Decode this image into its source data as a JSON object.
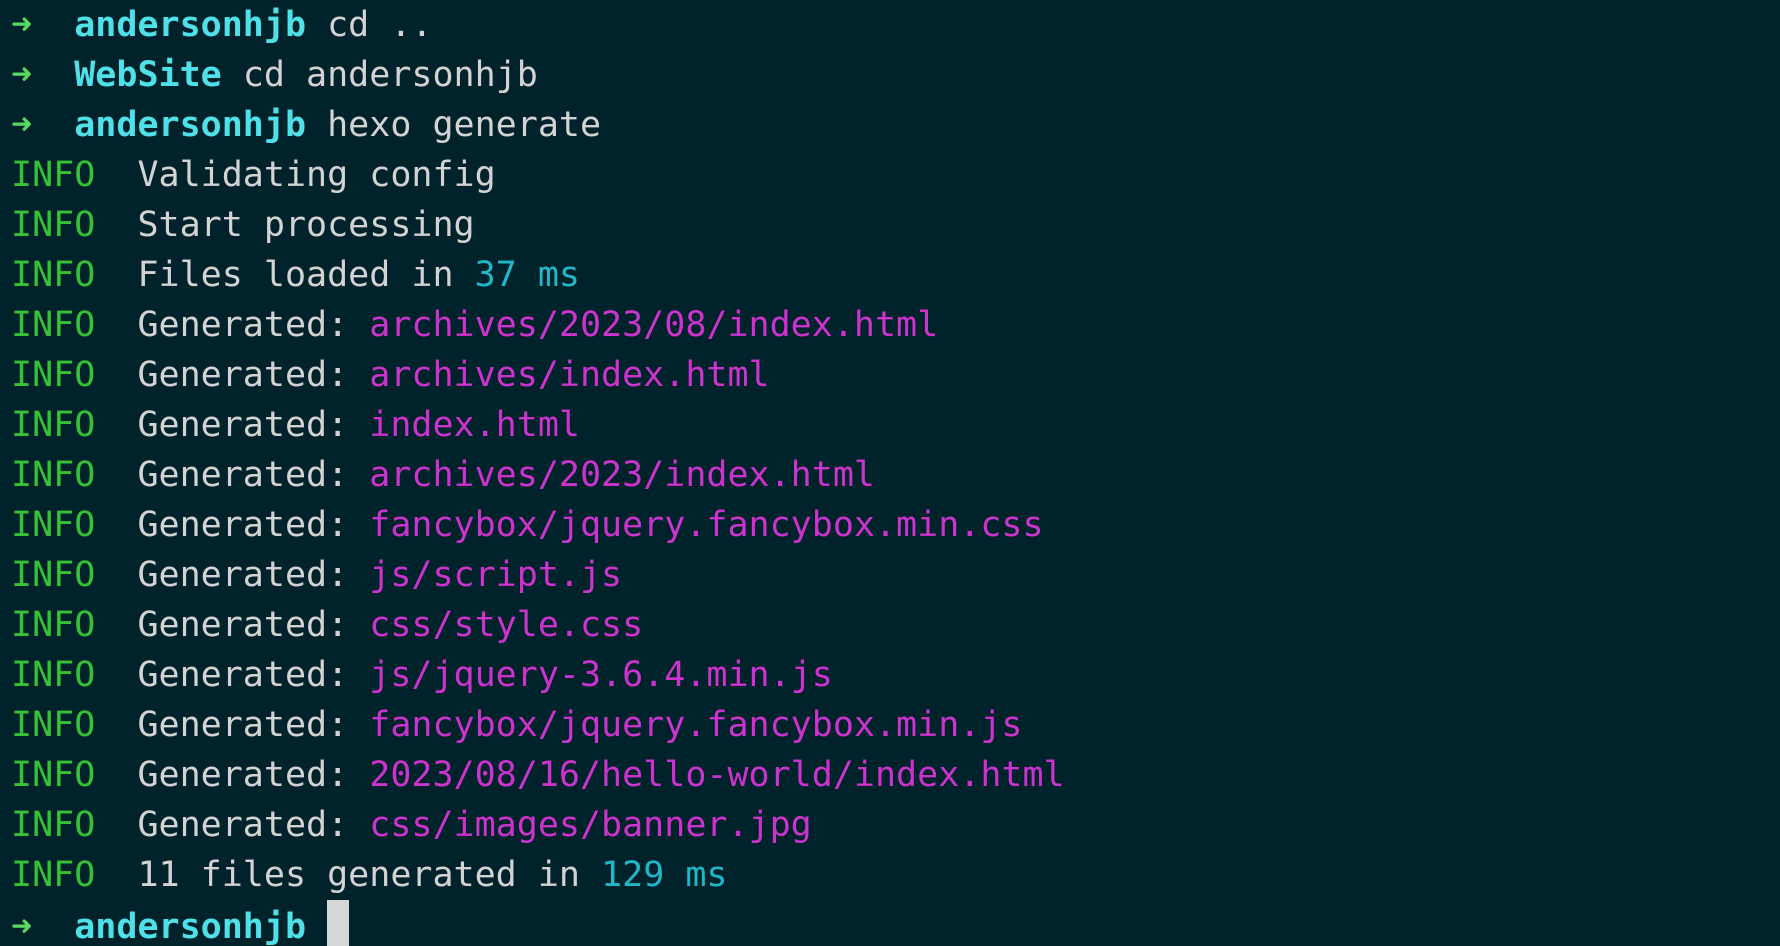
{
  "colors": {
    "background": "#00222b",
    "prompt_arrow": "#5ad962",
    "directory": "#4fe0e8",
    "info": "#36c236",
    "path": "#cc33cc",
    "number": "#20b8c8",
    "text": "#d3d3d3"
  },
  "prompt_symbol": "➜",
  "commands": [
    {
      "dir": "andersonhjb",
      "cmd": "cd .."
    },
    {
      "dir": "WebSite",
      "cmd": "cd andersonhjb"
    },
    {
      "dir": "andersonhjb",
      "cmd": "hexo generate"
    }
  ],
  "log": {
    "level": "INFO",
    "validating": "Validating config",
    "processing": "Start processing",
    "files_loaded_prefix": "Files loaded in",
    "files_loaded_value": "37 ms",
    "generated_label": "Generated:",
    "generated_files": [
      "archives/2023/08/index.html",
      "archives/index.html",
      "index.html",
      "archives/2023/index.html",
      "fancybox/jquery.fancybox.min.css",
      "js/script.js",
      "css/style.css",
      "js/jquery-3.6.4.min.js",
      "fancybox/jquery.fancybox.min.js",
      "2023/08/16/hello-world/index.html",
      "css/images/banner.jpg"
    ],
    "summary_prefix": "11 files generated in",
    "summary_value": "129 ms"
  },
  "current_prompt": {
    "dir": "andersonhjb"
  }
}
